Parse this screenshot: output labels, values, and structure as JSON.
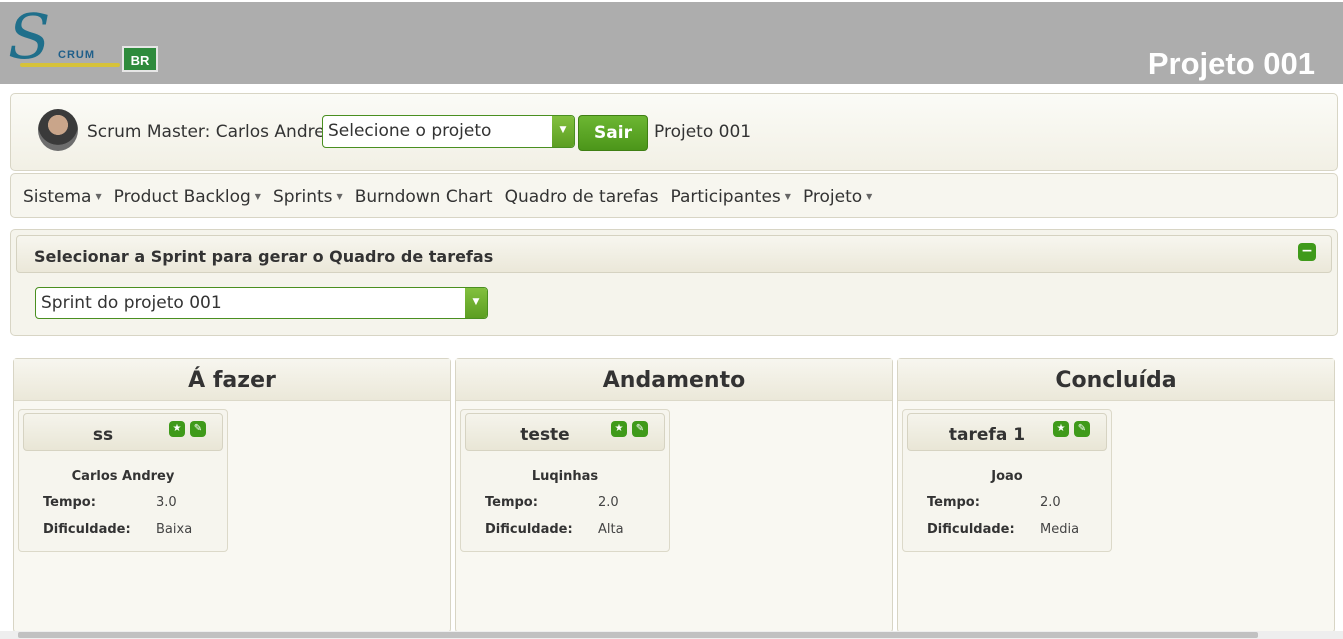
{
  "header": {
    "logo_letter": "S",
    "logo_text": "CRUM",
    "logo_badge": "BR",
    "project_title": "Projeto 001"
  },
  "userbar": {
    "scrum_master_label": "Scrum Master: Carlos Andrey",
    "project_select_value": "Selecione o projeto",
    "logout_label": "Sair",
    "current_project": "Projeto 001"
  },
  "menu": {
    "items": [
      {
        "label": "Sistema",
        "has_dropdown": true
      },
      {
        "label": "Product Backlog",
        "has_dropdown": true
      },
      {
        "label": "Sprints",
        "has_dropdown": true
      },
      {
        "label": "Burndown Chart",
        "has_dropdown": false
      },
      {
        "label": "Quadro de tarefas",
        "has_dropdown": false
      },
      {
        "label": "Participantes",
        "has_dropdown": true
      },
      {
        "label": "Projeto",
        "has_dropdown": true
      }
    ]
  },
  "sprint_panel": {
    "title": "Selecionar a Sprint para gerar o Quadro de tarefas",
    "sprint_select_value": "Sprint do projeto 001"
  },
  "board": {
    "columns": [
      {
        "title": "Á fazer",
        "cards": [
          {
            "title": "ss",
            "assignee": "Carlos Andrey",
            "tempo_label": "Tempo:",
            "tempo": "3.0",
            "dificuldade_label": "Dificuldade:",
            "dificuldade": "Baixa"
          }
        ]
      },
      {
        "title": "Andamento",
        "cards": [
          {
            "title": "teste",
            "assignee": "Luqinhas",
            "tempo_label": "Tempo:",
            "tempo": "2.0",
            "dificuldade_label": "Dificuldade:",
            "dificuldade": "Alta"
          }
        ]
      },
      {
        "title": "Concluída",
        "cards": [
          {
            "title": "tarefa 1",
            "assignee": "Joao",
            "tempo_label": "Tempo:",
            "tempo": "2.0",
            "dificuldade_label": "Dificuldade:",
            "dificuldade": "Media"
          }
        ]
      }
    ]
  },
  "colors": {
    "header_bg": "#adadad",
    "accent_green": "#5c9e22",
    "panel_bg": "#f7f6ef"
  },
  "icons": {
    "star": "star-icon",
    "edit": "pencil-icon",
    "collapse": "minus-icon",
    "dropdown": "caret-down-icon"
  }
}
